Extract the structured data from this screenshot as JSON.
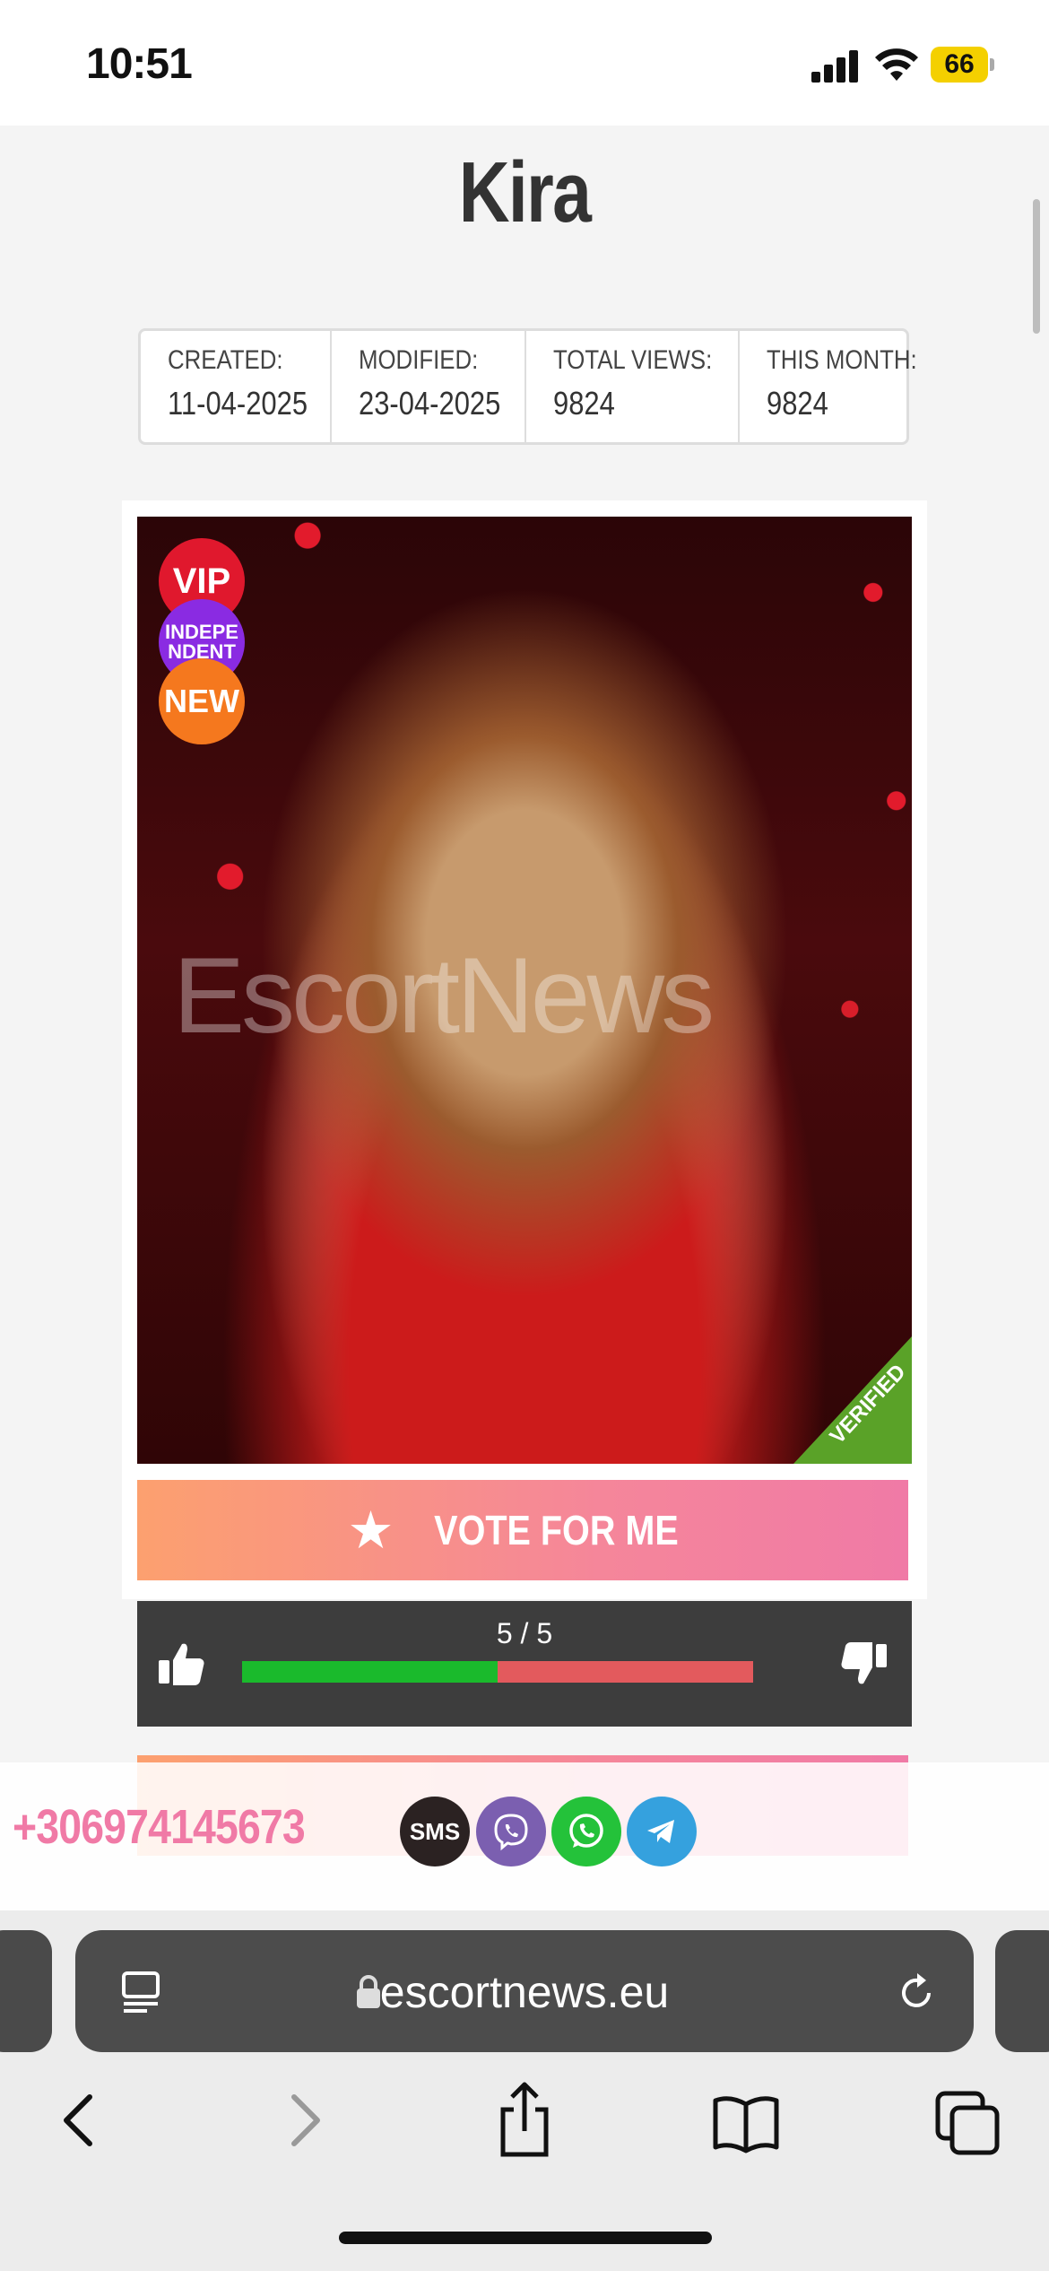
{
  "status_bar": {
    "time": "10:51",
    "battery": "66"
  },
  "page": {
    "title": "Kira"
  },
  "stats": [
    {
      "label": "CREATED:",
      "value": "11-04-2025"
    },
    {
      "label": "MODIFIED:",
      "value": "23-04-2025"
    },
    {
      "label": "TOTAL VIEWS:",
      "value": "9824"
    },
    {
      "label": "THIS MONTH:",
      "value": "9824"
    }
  ],
  "photo": {
    "watermark": "EscortNews",
    "badges": {
      "vip": "VIP",
      "independent": "INDEPE NDENT",
      "new": "NEW"
    },
    "verified": "VERIFIED"
  },
  "vote": {
    "label": "VOTE FOR ME"
  },
  "rating": {
    "text": "5 / 5",
    "fraction": 0.5
  },
  "contact": {
    "phone": "+306974145673",
    "sms": "SMS"
  },
  "browser": {
    "url": "escortnews.eu"
  },
  "colors": {
    "accent": "#f07aa6",
    "vip": "#e0182d",
    "independent": "#8a2be2",
    "new": "#f5781e",
    "verified": "#5aa228"
  }
}
